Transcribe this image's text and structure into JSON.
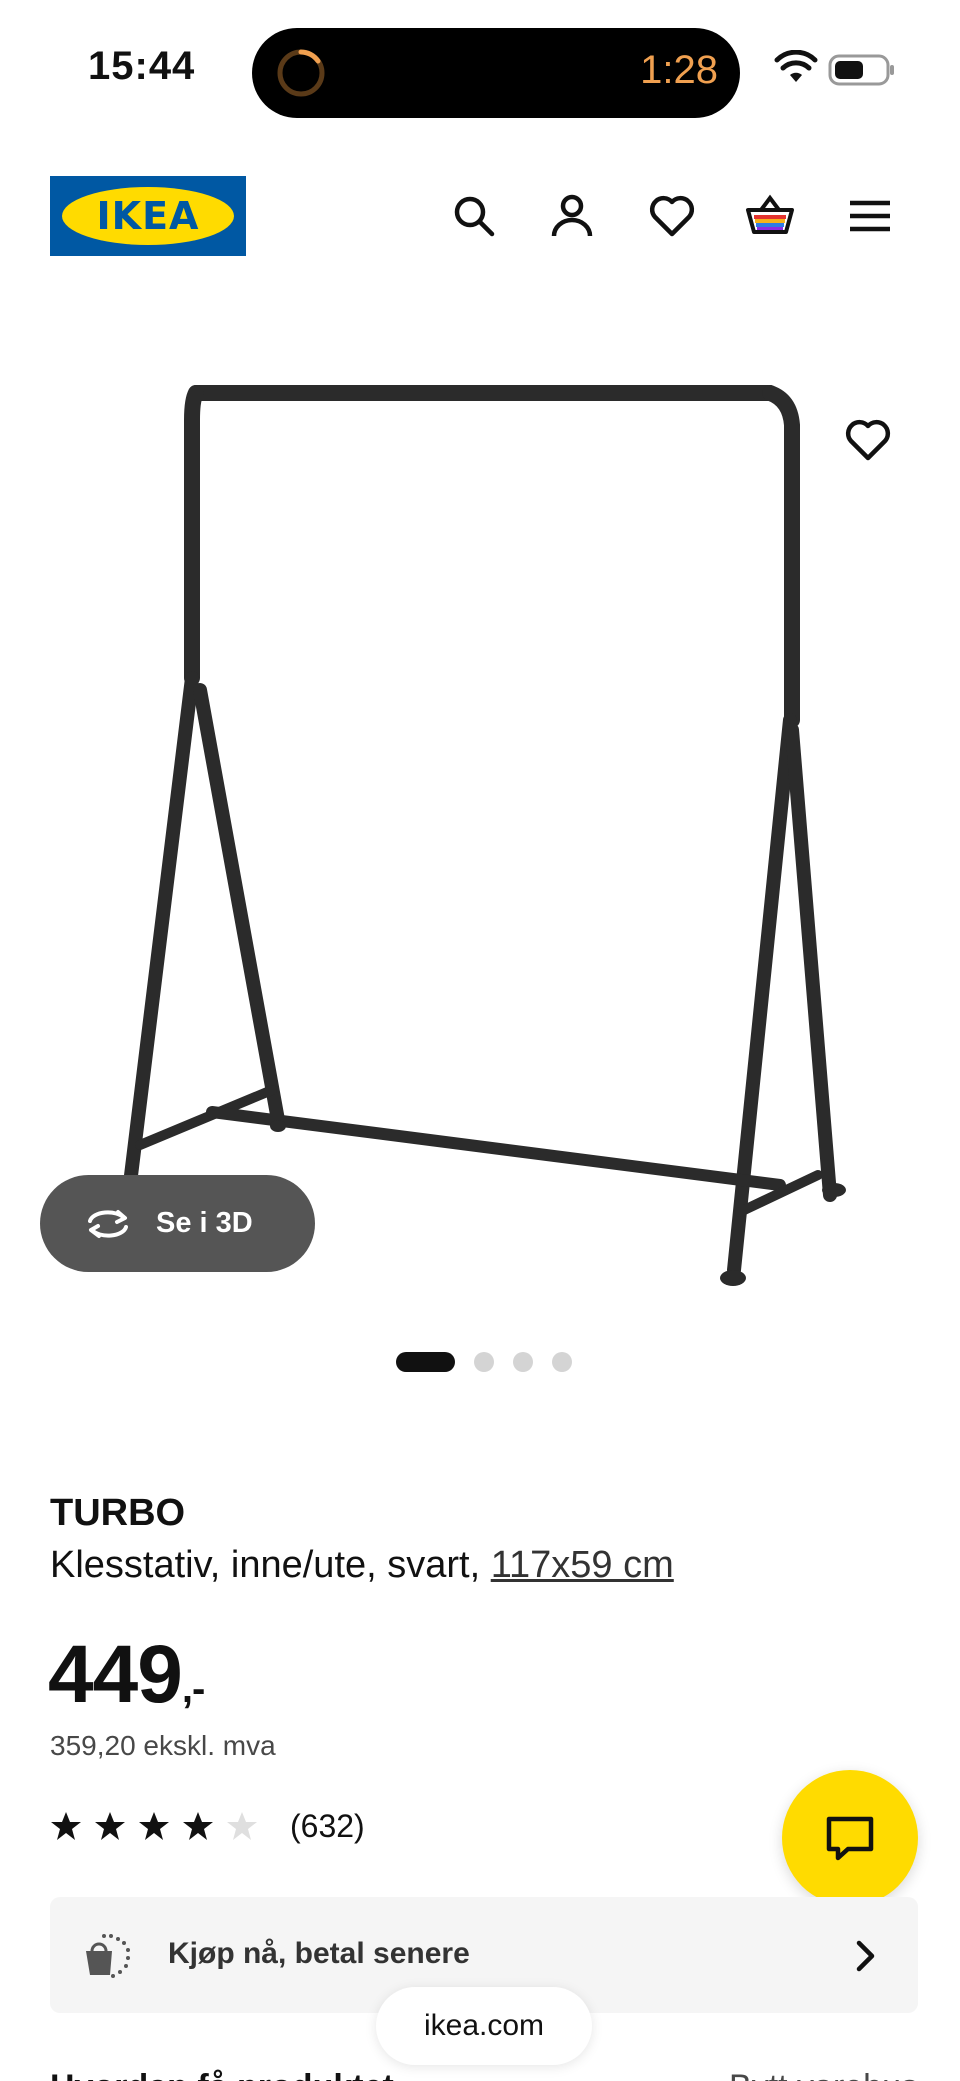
{
  "status_bar": {
    "time": "15:44",
    "timer": "1:28",
    "icons": [
      "timer-ring-icon",
      "wifi-icon",
      "battery-icon"
    ]
  },
  "header": {
    "logo_text": "IKEA",
    "icons": [
      "search-icon",
      "account-icon",
      "heart-icon",
      "basket-icon",
      "menu-icon"
    ]
  },
  "product": {
    "name": "TURBO",
    "description": "Klesstativ, inne/ute, svart, ",
    "size_link": "117x59 cm",
    "price": "449",
    "price_suffix": ",-",
    "price_ex_vat": "359,20 ekskl. mva",
    "rating_stars": 4,
    "rating_max": 5,
    "review_count": "(632)"
  },
  "gallery": {
    "view_3d_label": "Se i 3D",
    "total_images": 4,
    "active_index": 0
  },
  "pay_later": {
    "label": "Kjøp nå, betal senere"
  },
  "browser": {
    "url": "ikea.com"
  },
  "delivery": {
    "title": "Hvordan få produktet",
    "change_store": "Bytt varehus"
  },
  "colors": {
    "ikea_blue": "#0058a3",
    "ikea_yellow": "#ffdb00",
    "button_dark": "#555555",
    "star": "#111111",
    "star_empty": "#dfdfdf"
  }
}
